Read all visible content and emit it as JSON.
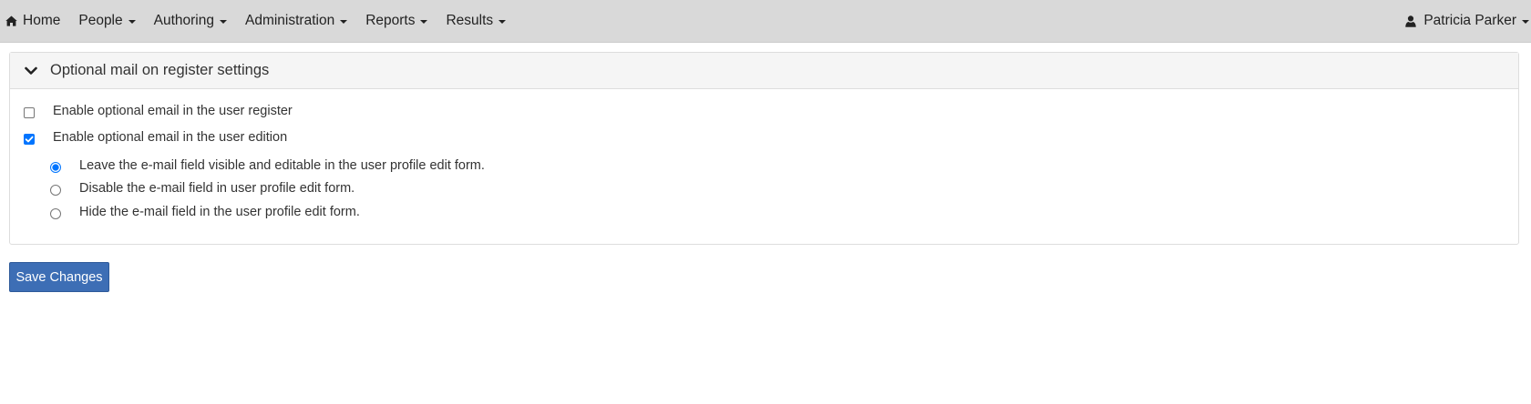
{
  "navbar": {
    "items": [
      {
        "label": "Home",
        "icon": "home-icon",
        "dropdown": false
      },
      {
        "label": "People",
        "dropdown": true
      },
      {
        "label": "Authoring",
        "dropdown": true
      },
      {
        "label": "Administration",
        "dropdown": true
      },
      {
        "label": "Reports",
        "dropdown": true
      },
      {
        "label": "Results",
        "dropdown": true
      }
    ],
    "user": {
      "name": "Patricia Parker",
      "icon": "user-icon",
      "dropdown": true
    }
  },
  "panel": {
    "title": "Optional mail on register settings",
    "expanded": true,
    "options": [
      {
        "label": "Enable optional email in the user register",
        "checked": false
      },
      {
        "label": "Enable optional email in the user edition",
        "checked": true
      }
    ],
    "radio_group": {
      "options": [
        {
          "label": "Leave the e-mail field visible and editable in the user profile edit form.",
          "selected": true
        },
        {
          "label": "Disable the e-mail field in user profile edit form.",
          "selected": false
        },
        {
          "label": "Hide the e-mail field in the user profile edit form.",
          "selected": false
        }
      ]
    }
  },
  "actions": {
    "save_label": "Save Changes"
  },
  "colors": {
    "navbar_bg": "#d9d9d9",
    "accent": "#0075ff",
    "button": "#3d6eb5"
  }
}
